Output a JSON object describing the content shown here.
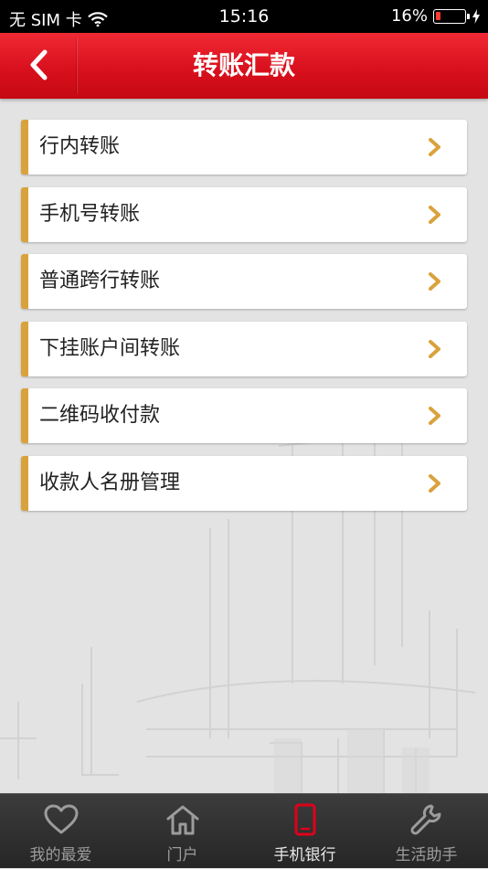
{
  "status_bar": {
    "carrier": "无 SIM 卡",
    "time": "15:16",
    "battery_percent": "16%",
    "battery_level": 0.16
  },
  "nav": {
    "title": "转账汇款"
  },
  "menu": {
    "items": [
      {
        "label": "行内转账"
      },
      {
        "label": "手机号转账"
      },
      {
        "label": "普通跨行转账"
      },
      {
        "label": "下挂账户间转账"
      },
      {
        "label": "二维码收付款"
      },
      {
        "label": "收款人名册管理"
      }
    ]
  },
  "tabs": [
    {
      "label": "我的最爱",
      "icon": "heart-icon"
    },
    {
      "label": "门户",
      "icon": "home-icon"
    },
    {
      "label": "手机银行",
      "icon": "phone-icon",
      "active": true
    },
    {
      "label": "生活助手",
      "icon": "wrench-icon"
    }
  ],
  "colors": {
    "nav_red": "#d9101d",
    "accent_gold": "#d9a23c",
    "tab_active": "#e0001a"
  }
}
